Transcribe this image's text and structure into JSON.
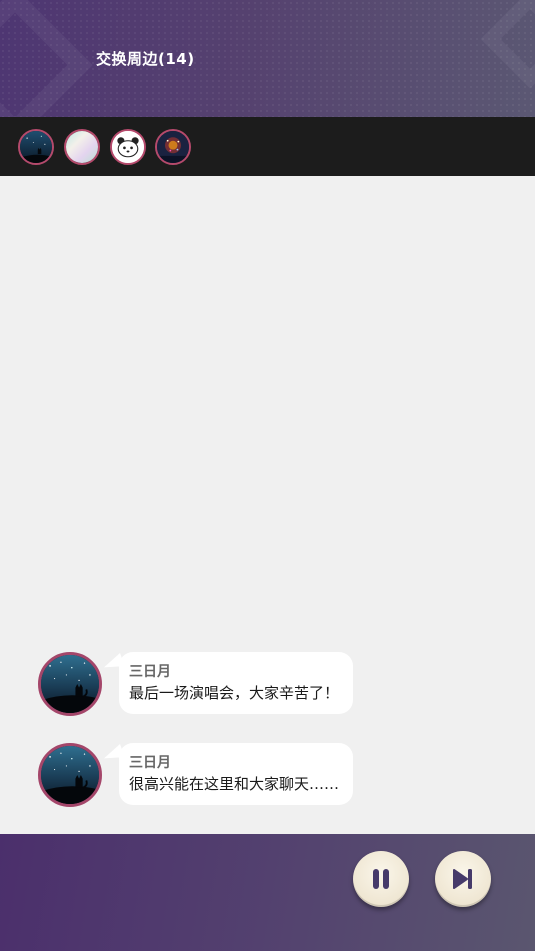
{
  "header": {
    "title": "交换周边(14)"
  },
  "members": [
    {
      "icon": "night-sky-cat-avatar"
    },
    {
      "icon": "iridescent-avatar"
    },
    {
      "icon": "panda-avatar"
    },
    {
      "icon": "fireworks-avatar"
    }
  ],
  "messages": [
    {
      "speaker": "三日月",
      "text": "最后一场演唱会，大家辛苦了！",
      "icon": "night-sky-cat-avatar"
    },
    {
      "speaker": "三日月",
      "text": "很高兴能在这里和大家聊天……",
      "icon": "night-sky-cat-avatar"
    }
  ],
  "controls": {
    "pause_icon": "pause-icon",
    "next_icon": "skip-next-icon"
  },
  "colors": {
    "header_purple": "#4e3672",
    "strip_dark": "#1c1c1c",
    "chat_bg": "#f0f0f0",
    "avatar_ring": "#b54a6c",
    "control_icon": "#463a6a",
    "control_button": "#f3ecdb"
  }
}
